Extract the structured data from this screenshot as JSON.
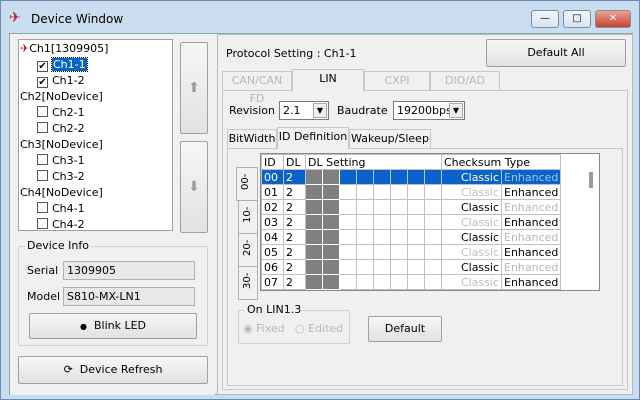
{
  "window": {
    "title": "Device Window",
    "minimize": "—",
    "maximize": "□",
    "close": "✕"
  },
  "tree": [
    {
      "label": "Ch1[1309905]",
      "children": [
        {
          "label": "Ch1-1",
          "checked": true,
          "selected": true
        },
        {
          "label": "Ch1-2",
          "checked": true
        }
      ]
    },
    {
      "label": "Ch2[NoDevice]",
      "children": [
        {
          "label": "Ch2-1",
          "checked": false
        },
        {
          "label": "Ch2-2",
          "checked": false
        }
      ]
    },
    {
      "label": "Ch3[NoDevice]",
      "children": [
        {
          "label": "Ch3-1",
          "checked": false
        },
        {
          "label": "Ch3-2",
          "checked": false
        }
      ]
    },
    {
      "label": "Ch4[NoDevice]",
      "children": [
        {
          "label": "Ch4-1",
          "checked": false
        },
        {
          "label": "Ch4-2",
          "checked": false
        }
      ]
    }
  ],
  "device_info": {
    "title": "Device Info",
    "serial_label": "Serial",
    "serial": "1309905",
    "model_label": "Model",
    "model": "S810-MX-LN1",
    "blink_label": "Blink LED"
  },
  "device_refresh": "Device Refresh",
  "protocol": {
    "label": "Protocol Setting : Ch1-1",
    "default_all": "Default All",
    "tabs": [
      {
        "label": "CAN/CAN FD",
        "enabled": false
      },
      {
        "label": "LIN",
        "active": true
      },
      {
        "label": "CXPI",
        "enabled": false
      },
      {
        "label": "DIO/AD",
        "enabled": false
      }
    ]
  },
  "lin": {
    "revision_label": "Revision",
    "revision": "2.1",
    "baudrate_label": "Baudrate",
    "baudrate": "19200bps",
    "subtabs": [
      "BitWidth",
      "ID Definition",
      "Wakeup/Sleep"
    ],
    "active_subtab": "ID Definition",
    "page_tabs": [
      "00-",
      "10-",
      "20-",
      "30-"
    ],
    "table": {
      "headers": [
        "ID",
        "DL",
        "DL Setting",
        "Checksum Type"
      ],
      "classic": "Classic",
      "enhanced": "Enhanced",
      "rows": [
        {
          "id": "00",
          "dl": "2",
          "checksum": "Classic",
          "selected": true
        },
        {
          "id": "01",
          "dl": "2",
          "checksum": "Enhanced"
        },
        {
          "id": "02",
          "dl": "2",
          "checksum": "Classic"
        },
        {
          "id": "03",
          "dl": "2",
          "checksum": "Enhanced"
        },
        {
          "id": "04",
          "dl": "2",
          "checksum": "Classic"
        },
        {
          "id": "05",
          "dl": "2",
          "checksum": "Enhanced"
        },
        {
          "id": "06",
          "dl": "2",
          "checksum": "Classic"
        },
        {
          "id": "07",
          "dl": "2",
          "checksum": "Enhanced"
        }
      ]
    },
    "on_lin13": {
      "title": "On LIN1.3",
      "fixed": "Fixed",
      "edited": "Edited"
    },
    "default": "Default"
  }
}
